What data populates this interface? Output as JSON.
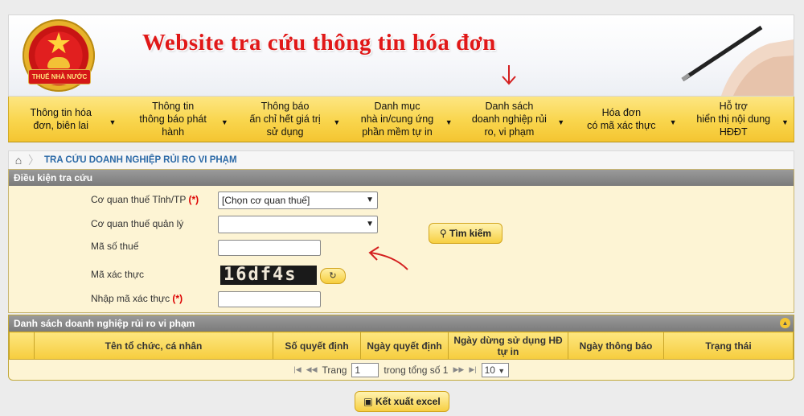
{
  "header": {
    "emblem_text": "THUẾ NHÀ NƯỚC",
    "title": "Website tra cứu thông tin hóa đơn"
  },
  "nav": [
    {
      "label": "Thông tin hóa\nđơn, biên lai"
    },
    {
      "label": "Thông tin\nthông báo phát\nhành"
    },
    {
      "label": "Thông báo\nấn chỉ hết giá trị\nsử dụng"
    },
    {
      "label": "Danh mục\nnhà in/cung ứng\nphần mềm tự in"
    },
    {
      "label": "Danh sách\ndoanh nghiệp rủi\nro, vi phạm"
    },
    {
      "label": "Hóa đơn\ncó mã xác thực"
    },
    {
      "label": "Hỗ trợ\nhiển thị nội dung\nHĐĐT"
    }
  ],
  "breadcrumb": {
    "current": "TRA CỨU DOANH NGHIỆP RỦI RO VI PHẠM"
  },
  "search_panel": {
    "title": "Điều kiện tra cứu",
    "fields": {
      "province_label": "Cơ quan thuế Tỉnh/TP",
      "province_value": "[Chọn cơ quan thuế]",
      "manager_label": "Cơ quan thuế quản lý",
      "manager_value": "",
      "tax_code_label": "Mã số thuế",
      "captcha_label": "Mã xác thực",
      "captcha_text": "16df4s",
      "captcha_input_label": "Nhập mã xác thực",
      "required_mark": "(*)"
    },
    "search_button": "Tìm kiếm"
  },
  "results_panel": {
    "title": "Danh sách doanh nghiệp rủi ro vi phạm",
    "columns": [
      "",
      "Tên tổ chức, cá nhân",
      "Số quyết định",
      "Ngày quyết định",
      "Ngày dừng sử dụng HĐ tự in",
      "Ngày thông báo",
      "Trạng thái"
    ],
    "pager": {
      "page_label": "Trang",
      "page_value": "1",
      "total_label": "trong tổng số 1",
      "page_size": "10"
    }
  },
  "export_button": "Kết xuất excel",
  "colors": {
    "accent_red": "#e01818",
    "nav_yellow": "#f9d54c",
    "link_blue": "#2c6aa7"
  }
}
